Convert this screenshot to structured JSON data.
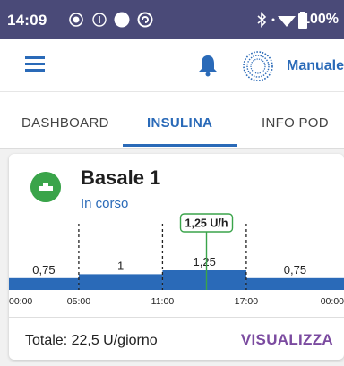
{
  "status_bar": {
    "time": "14:09",
    "battery": "100%",
    "icons": [
      "record-icon",
      "info-icon",
      "dot-icon",
      "sync-icon",
      "bluetooth-icon",
      "wifi-icon",
      "battery-icon"
    ]
  },
  "header": {
    "menu_icon": "hamburger-menu-icon",
    "bell_icon": "bell-icon",
    "pod_icon": "pod-status-icon",
    "mode_label": "Manuale"
  },
  "tabs": [
    {
      "label": "DASHBOARD",
      "active": false
    },
    {
      "label": "INSULINA",
      "active": true
    },
    {
      "label": "INFO POD",
      "active": false
    }
  ],
  "card": {
    "title": "Basale 1",
    "status": "In corso",
    "current_rate": "1,25 U/h",
    "total_label": "Totale:",
    "total_value": "22,5 U/giorno",
    "view_button": "VISUALIZZA"
  },
  "chart_data": {
    "type": "step-area",
    "x_ticks": [
      "00:00",
      "05:00",
      "11:00",
      "17:00",
      "00:00"
    ],
    "segments": [
      {
        "start": "00:00",
        "end": "05:00",
        "rate": 0.75,
        "label": "0,75"
      },
      {
        "start": "05:00",
        "end": "11:00",
        "rate": 1.0,
        "label": "1"
      },
      {
        "start": "11:00",
        "end": "17:00",
        "rate": 1.25,
        "label": "1,25"
      },
      {
        "start": "17:00",
        "end": "00:00",
        "rate": 0.75,
        "label": "0,75"
      }
    ],
    "current_time": "14:09",
    "current_rate": "1,25 U/h",
    "colors": {
      "bar": "#2a6ab8",
      "marker": "#3aa44a"
    }
  }
}
